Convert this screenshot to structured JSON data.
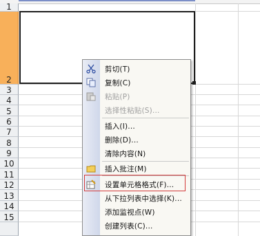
{
  "row_headers": [
    "1",
    "2",
    "3",
    "4",
    "5",
    "6",
    "7",
    "8",
    "9",
    "10",
    "11",
    "12",
    "13",
    "14",
    "15"
  ],
  "context_menu": {
    "items": [
      {
        "label": "剪切(T)",
        "icon": "scissors-icon",
        "disabled": false
      },
      {
        "label": "复制(C)",
        "icon": "copy-icon",
        "disabled": false
      },
      {
        "label": "粘贴(P)",
        "icon": "paste-icon",
        "disabled": true
      },
      {
        "label": "选择性粘贴(S)...",
        "icon": "",
        "disabled": true
      },
      {
        "label": "插入(I)...",
        "icon": "",
        "disabled": false
      },
      {
        "label": "删除(D)...",
        "icon": "",
        "disabled": false
      },
      {
        "label": "清除内容(N)",
        "icon": "",
        "disabled": false
      },
      {
        "label": "插入批注(M)",
        "icon": "folder-comment-icon",
        "disabled": false
      },
      {
        "label": "设置单元格格式(F)...",
        "icon": "format-cells-icon",
        "disabled": false
      },
      {
        "label": "从下拉列表中选择(K)...",
        "icon": "",
        "disabled": false
      },
      {
        "label": "添加监视点(W)",
        "icon": "",
        "disabled": false
      },
      {
        "label": "创建列表(C)...",
        "icon": "",
        "disabled": false
      }
    ]
  }
}
